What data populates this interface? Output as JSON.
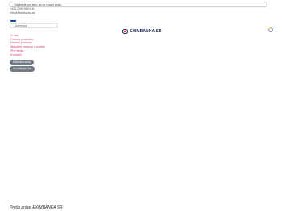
{
  "notice": {
    "text": "Odděleně pro text, ak vo s sa o portu"
  },
  "contact": {
    "phone": "+421 2 59 39 81 11",
    "email": "info@eximbanka.sk"
  },
  "language": {
    "selected": "Slovensky"
  },
  "logo": {
    "text": "EXIMBANKA SR"
  },
  "nav": {
    "items": [
      "O nás",
      "Ponuka produktov",
      "Poistné produkty",
      "Aktuálne podpory a portály",
      "Pre médiá",
      "Kontakty"
    ]
  },
  "buttons": {
    "client_zone": "Klientska zóna",
    "contact_us": "Kontaktujte nás"
  },
  "section": {
    "heading": "Prečo práve EXIMBANKA SR"
  },
  "colors": {
    "nav_link": "#d43f65",
    "button_bg": "#737b86",
    "logo_navy": "#1d2b5c",
    "logo_red": "#e3263a"
  }
}
